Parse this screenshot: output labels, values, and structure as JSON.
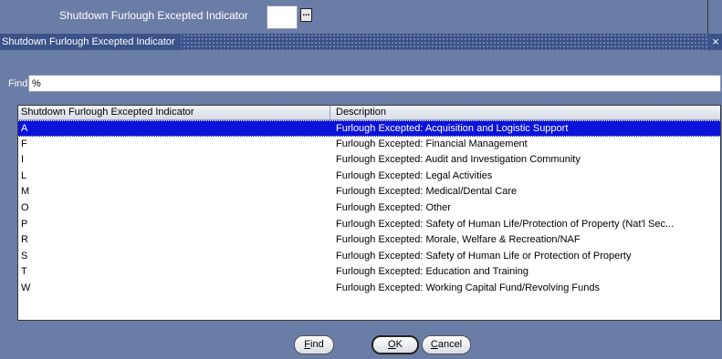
{
  "background_form": {
    "field_label": "Shutdown Furlough Excepted Indicator",
    "field_value": "",
    "lov_button_label": "..."
  },
  "dialog": {
    "title": "Shutdown Furlough Excepted Indicator",
    "close_label": "×",
    "find_label": "Find",
    "find_value": "%",
    "columns": [
      "Shutdown Furlough Excepted Indicator",
      "Description"
    ],
    "rows": [
      {
        "code": "A",
        "description": "Furlough Excepted:  Acquisition and Logistic Support"
      },
      {
        "code": "F",
        "description": "Furlough Excepted:  Financial Management"
      },
      {
        "code": "I",
        "description": "Furlough Excepted:  Audit and Investigation Community"
      },
      {
        "code": "L",
        "description": "Furlough Excepted:  Legal Activities"
      },
      {
        "code": "M",
        "description": "Furlough Excepted:  Medical/Dental Care"
      },
      {
        "code": "O",
        "description": "Furlough Excepted:  Other"
      },
      {
        "code": "P",
        "description": "Furlough Excepted:  Safety of Human Life/Protection of Property (Nat'l Sec..."
      },
      {
        "code": "R",
        "description": "Furlough Excepted:  Morale, Welfare & Recreation/NAF"
      },
      {
        "code": "S",
        "description": "Furlough Excepted:  Safety of Human Life or Protection of Property"
      },
      {
        "code": "T",
        "description": "Furlough Excepted:  Education and Training"
      },
      {
        "code": "W",
        "description": "Furlough Excepted:  Working Capital Fund/Revolving Funds"
      }
    ],
    "selected_row": 0,
    "buttons": {
      "find": {
        "mnemonic": "F",
        "rest": "ind"
      },
      "ok": {
        "mnemonic": "O",
        "rest": "K"
      },
      "cancel": {
        "mnemonic": "C",
        "rest": "ancel"
      }
    }
  },
  "colors": {
    "background": "#6a7da6",
    "titlebar": "#3b5389",
    "selection": "#0b13d8"
  }
}
